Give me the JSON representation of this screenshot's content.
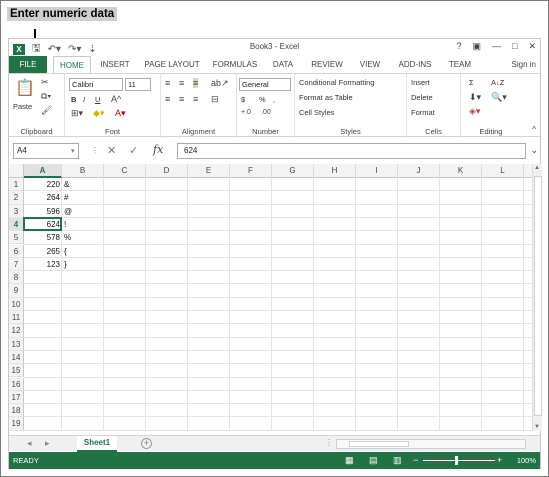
{
  "caption": "Enter numeric data",
  "window": {
    "title": "Book3 - Excel",
    "controls": [
      "?",
      "▣",
      "—",
      "□",
      "✕"
    ]
  },
  "qat": {
    "logo": "X",
    "save_icon": "save-icon",
    "undo_icon": "undo-icon",
    "redo_icon": "redo-icon"
  },
  "tabs": [
    "FILE",
    "HOME",
    "INSERT",
    "PAGE LAYOUT",
    "FORMULAS",
    "DATA",
    "REVIEW",
    "VIEW",
    "ADD-INS",
    "TEAM"
  ],
  "sign_in": "Sign in",
  "ribbon": {
    "clipboard": {
      "label": "Clipboard",
      "paste": "Paste"
    },
    "font": {
      "label": "Font",
      "name": "Calibri",
      "size": "11",
      "bold": "B",
      "italic": "I",
      "underline": "U"
    },
    "alignment": {
      "label": "Alignment"
    },
    "number": {
      "label": "Number",
      "format": "General",
      "currency": "$",
      "percent": "%",
      "comma": ","
    },
    "styles": {
      "label": "Styles",
      "conditional": "Conditional Formatting",
      "format_table": "Format as Table",
      "cell_styles": "Cell Styles"
    },
    "cells": {
      "label": "Cells",
      "insert": "Insert",
      "delete": "Delete",
      "format": "Format"
    },
    "editing": {
      "label": "Editing",
      "sum": "Σ",
      "sort": "A↓Z"
    }
  },
  "formula_bar": {
    "name_box": "A4",
    "fx": "fx",
    "value": "624"
  },
  "columns": [
    "A",
    "B",
    "C",
    "D",
    "E",
    "F",
    "G",
    "H",
    "I",
    "J",
    "K",
    "L"
  ],
  "rows": [
    "1",
    "2",
    "3",
    "4",
    "5",
    "6",
    "7",
    "8",
    "9",
    "10",
    "11",
    "12",
    "13",
    "14",
    "15",
    "16",
    "17",
    "18",
    "19"
  ],
  "cells": {
    "A": [
      "220",
      "264",
      "596",
      "624",
      "578",
      "265",
      "123"
    ],
    "B": [
      "&",
      "#",
      "@",
      "!",
      "%",
      "{",
      "}"
    ]
  },
  "active_cell": "A4",
  "sheet": {
    "tab": "Sheet1",
    "add": "+"
  },
  "status": {
    "ready": "READY",
    "zoom": "100%"
  },
  "colors": {
    "excel_green": "#217346"
  }
}
